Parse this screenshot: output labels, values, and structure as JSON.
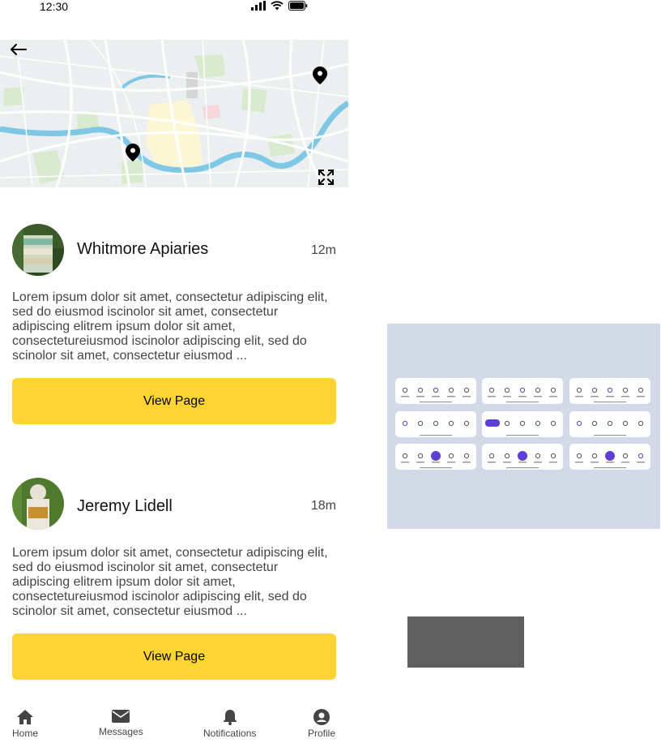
{
  "status_bar": {
    "time": "12:30"
  },
  "map": {
    "back_label": "back",
    "expand_label": "expand"
  },
  "posts": [
    {
      "name": "Whitmore Apiaries",
      "time": "12m",
      "body": "Lorem ipsum dolor sit amet, consectetur adipiscing elit, sed do eiusmod iscinolor sit amet, consectetur adipiscing elitrem ipsum dolor sit amet, consectetureiusmod iscinolor adipiscing elit, sed do scinolor sit amet, consectetur eiusmod ...",
      "button_label": "View Page"
    },
    {
      "name": "Jeremy Lidell",
      "time": "18m",
      "body": "Lorem ipsum dolor sit amet, consectetur adipiscing elit, sed do eiusmod iscinolor sit amet, consectetur adipiscing elitrem ipsum dolor sit amet, consectetureiusmod iscinolor adipiscing elit, sed do scinolor sit amet, consectetur eiusmod ...",
      "button_label": "View Page"
    }
  ],
  "bottom_nav": {
    "items": [
      {
        "label": "Home",
        "icon": "home-icon"
      },
      {
        "label": "Messages",
        "icon": "envelope-icon"
      },
      {
        "label": "Notifications",
        "icon": "bell-icon"
      },
      {
        "label": "Profile",
        "icon": "user-circle-icon"
      }
    ]
  },
  "colors": {
    "accent": "#fdd432",
    "panel_bg": "#d2dae7",
    "nav_accent": "#5b3fd6",
    "placeholder_box": "#5e5e5e"
  }
}
